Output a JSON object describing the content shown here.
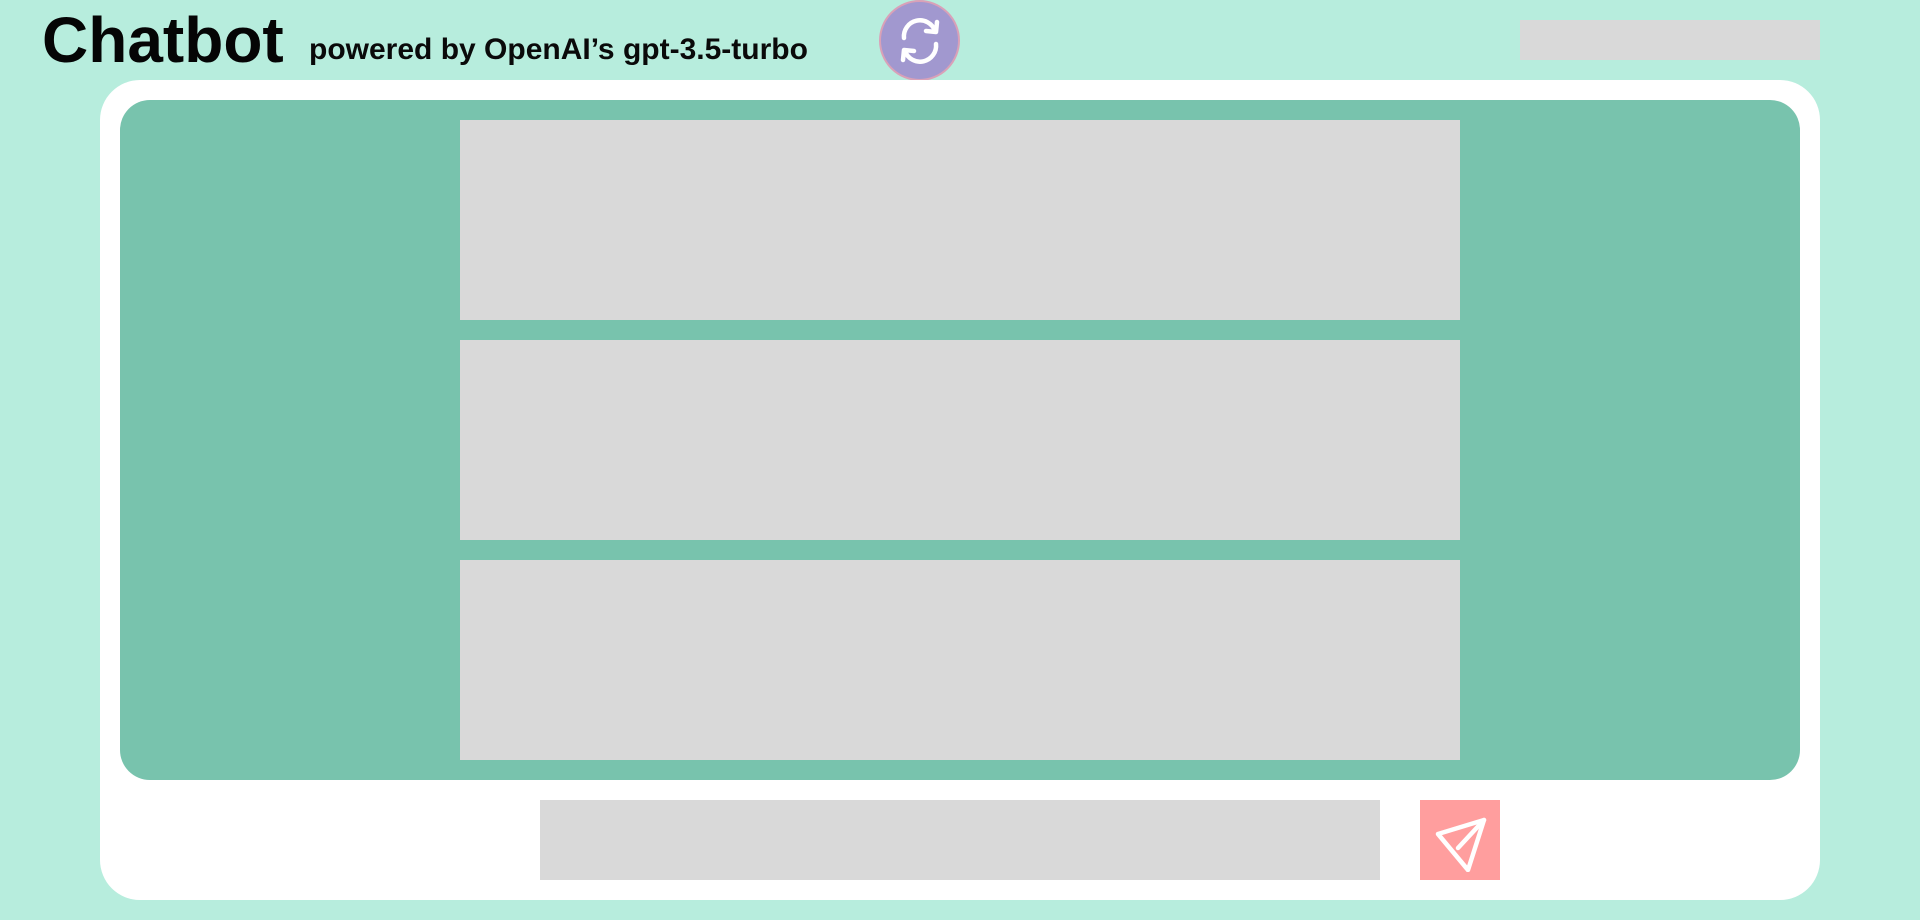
{
  "header": {
    "title": "Chatbot",
    "subtitle": "powered by OpenAI’s gpt-3.5-turbo"
  },
  "icons": {
    "refresh": "refresh-icon",
    "send": "send-icon"
  },
  "colors": {
    "page_background": "#b7eddd",
    "card_background": "#ffffff",
    "messages_panel": "#78c3ad",
    "placeholder": "#d9d9d9",
    "refresh_button": "#a198cf",
    "send_button": "#ff9e9e"
  },
  "messages": [
    "",
    "",
    ""
  ],
  "composer": {
    "value": "",
    "placeholder": ""
  }
}
